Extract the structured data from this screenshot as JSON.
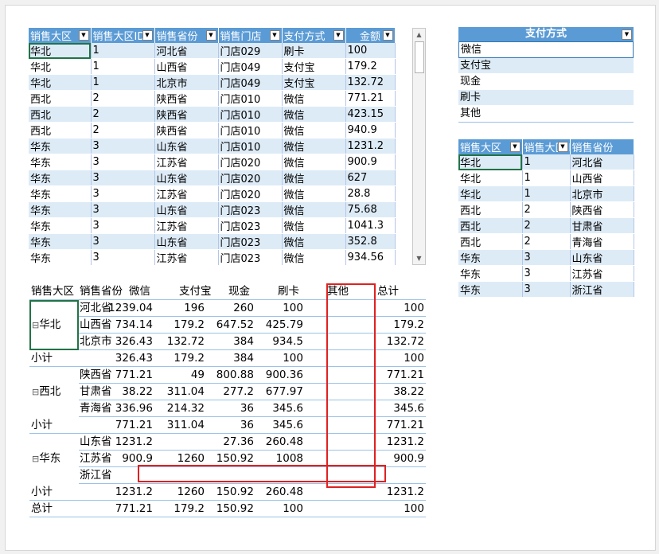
{
  "colors": {
    "header": "#5b9bd5",
    "band": "#ddebf7",
    "highlight": "#e02020",
    "selection": "#217346"
  },
  "source_table": {
    "headers": [
      "销售大区",
      "销售大区ID",
      "销售省份",
      "销售门店",
      "支付方式",
      "金额"
    ],
    "rows": [
      [
        "华北",
        "1",
        "河北省",
        "门店029",
        "刷卡",
        "100"
      ],
      [
        "华北",
        "1",
        "山西省",
        "门店049",
        "支付宝",
        "179.2"
      ],
      [
        "华北",
        "1",
        "北京市",
        "门店049",
        "支付宝",
        "132.72"
      ],
      [
        "西北",
        "2",
        "陕西省",
        "门店010",
        "微信",
        "771.21"
      ],
      [
        "西北",
        "2",
        "陕西省",
        "门店010",
        "微信",
        "423.15"
      ],
      [
        "西北",
        "2",
        "陕西省",
        "门店010",
        "微信",
        "940.9"
      ],
      [
        "华东",
        "3",
        "山东省",
        "门店010",
        "微信",
        "1231.2"
      ],
      [
        "华东",
        "3",
        "江苏省",
        "门店020",
        "微信",
        "900.9"
      ],
      [
        "华东",
        "3",
        "山东省",
        "门店020",
        "微信",
        "627"
      ],
      [
        "华东",
        "3",
        "江苏省",
        "门店020",
        "微信",
        "28.8"
      ],
      [
        "华东",
        "3",
        "山东省",
        "门店023",
        "微信",
        "75.68"
      ],
      [
        "华东",
        "3",
        "江苏省",
        "门店023",
        "微信",
        "1041.3"
      ],
      [
        "华东",
        "3",
        "山东省",
        "门店023",
        "微信",
        "352.8"
      ],
      [
        "华东",
        "3",
        "江苏省",
        "门店023",
        "微信",
        "934.56"
      ]
    ]
  },
  "slicer": {
    "title": "支付方式",
    "items": [
      "微信",
      "支付宝",
      "现金",
      "刷卡",
      "其他"
    ],
    "selected": "微信"
  },
  "region_table": {
    "headers": [
      "销售大区",
      "销售大区ID",
      "销售省份"
    ],
    "rows": [
      [
        "华北",
        "1",
        "河北省"
      ],
      [
        "华北",
        "1",
        "山西省"
      ],
      [
        "华北",
        "1",
        "北京市"
      ],
      [
        "西北",
        "2",
        "陕西省"
      ],
      [
        "西北",
        "2",
        "甘肃省"
      ],
      [
        "西北",
        "2",
        "青海省"
      ],
      [
        "华东",
        "3",
        "山东省"
      ],
      [
        "华东",
        "3",
        "江苏省"
      ],
      [
        "华东",
        "3",
        "浙江省"
      ]
    ]
  },
  "pivot": {
    "headers": [
      "销售大区",
      "销售省份",
      "微信",
      "支付宝",
      "现金",
      "刷卡",
      "其他",
      "总计"
    ],
    "collapse_glyph": "⊟",
    "groups": [
      {
        "region": "华北",
        "rows": [
          [
            "河北省",
            "1239.04",
            "196",
            "260",
            "100",
            "",
            "100"
          ],
          [
            "山西省",
            "734.14",
            "179.2",
            "647.52",
            "425.79",
            "",
            "179.2"
          ],
          [
            "北京市",
            "326.43",
            "132.72",
            "384",
            "934.5",
            "",
            "132.72"
          ]
        ],
        "subtotal": [
          "小计",
          "326.43",
          "179.2",
          "384",
          "100",
          "",
          "100"
        ]
      },
      {
        "region": "西北",
        "rows": [
          [
            "陕西省",
            "771.21",
            "49",
            "800.88",
            "900.36",
            "",
            "771.21"
          ],
          [
            "甘肃省",
            "38.22",
            "311.04",
            "277.2",
            "677.97",
            "",
            "38.22"
          ],
          [
            "青海省",
            "336.96",
            "214.32",
            "36",
            "345.6",
            "",
            "345.6"
          ]
        ],
        "subtotal": [
          "小计",
          "771.21",
          "311.04",
          "36",
          "345.6",
          "",
          "771.21"
        ]
      },
      {
        "region": "华东",
        "rows": [
          [
            "山东省",
            "1231.2",
            "",
            "27.36",
            "260.48",
            "",
            "1231.2"
          ],
          [
            "江苏省",
            "900.9",
            "1260",
            "150.92",
            "1008",
            "",
            "900.9"
          ],
          [
            "浙江省",
            "",
            "",
            "",
            "",
            "",
            ""
          ]
        ],
        "subtotal": [
          "小计",
          "1231.2",
          "1260",
          "150.92",
          "260.48",
          "",
          "1231.2"
        ]
      }
    ],
    "total": [
      "总计",
      "771.21",
      "179.2",
      "150.92",
      "100",
      "",
      "100"
    ]
  }
}
